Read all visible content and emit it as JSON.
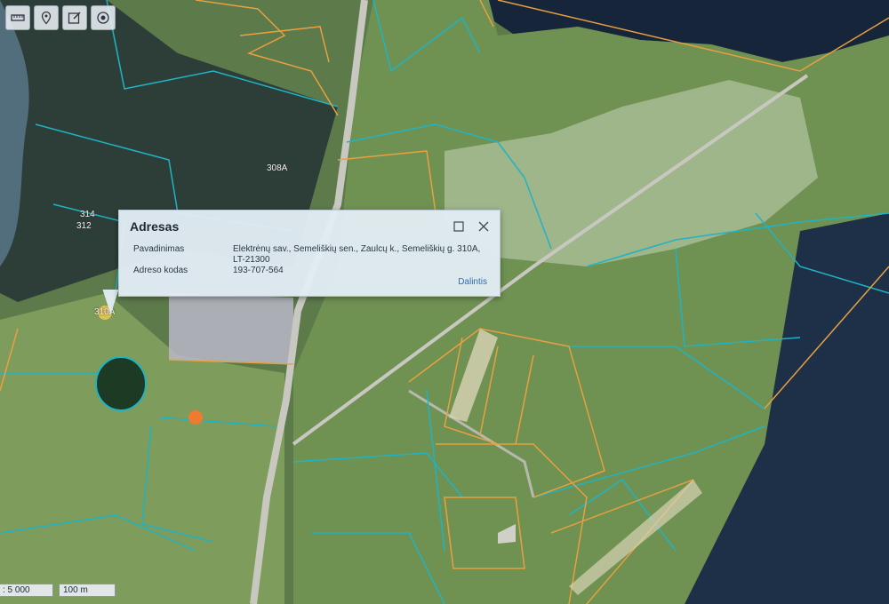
{
  "toolbar": {
    "buttons": [
      {
        "icon": "ruler-icon"
      },
      {
        "icon": "marker-icon"
      },
      {
        "icon": "edit-icon"
      },
      {
        "icon": "target-icon"
      }
    ]
  },
  "popup": {
    "title": "Adresas",
    "rows": [
      {
        "label": "Pavadinimas",
        "value": "Elektrėnų sav., Semeliškių sen., Zaulcų k., Semeliškių g. 310A, LT-21300"
      },
      {
        "label": "Adreso kodas",
        "value": "193-707-564"
      }
    ],
    "share_label": "Dalintis"
  },
  "parcels": {
    "p1": "308A",
    "p2": "314",
    "p3": "312",
    "p4": "310A"
  },
  "scale": {
    "ratio": ": 5 000",
    "bar": "100 m"
  },
  "colors": {
    "parcel_cyan": "#1fb4c4",
    "parcel_orange": "#e8a040",
    "marker": "#f07a30"
  }
}
